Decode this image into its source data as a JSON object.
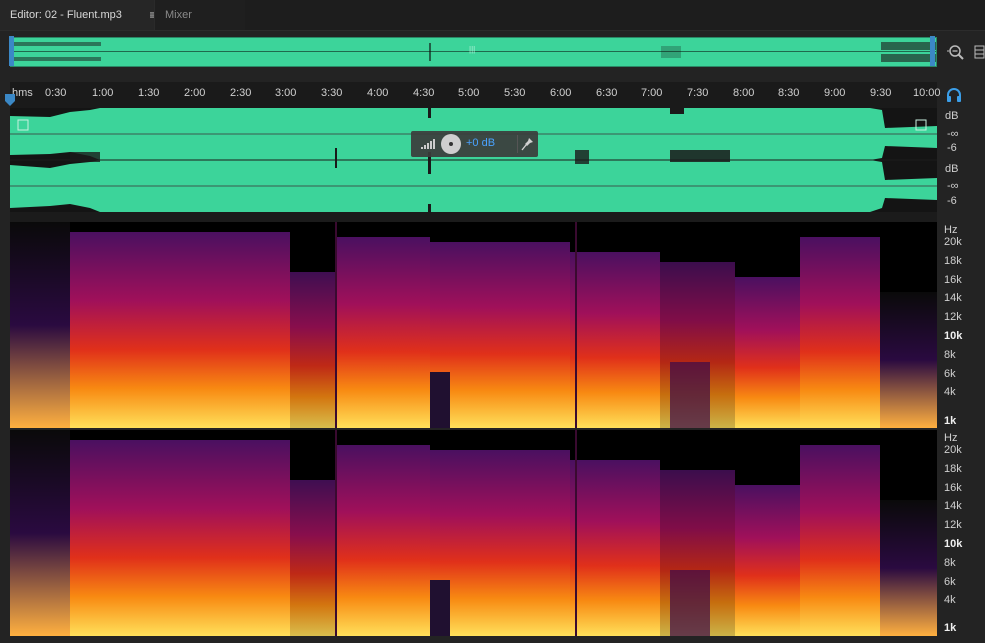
{
  "tabs": {
    "editor_label": "Editor: 02 - Fluent.mp3",
    "menu_glyph": "≡",
    "mixer_label": "Mixer"
  },
  "overview": {
    "selection_marker": "|||"
  },
  "ruler": {
    "unit": "hms",
    "ticks": [
      "0:30",
      "1:00",
      "1:30",
      "2:00",
      "2:30",
      "3:00",
      "3:30",
      "4:00",
      "4:30",
      "5:00",
      "5:30",
      "6:00",
      "6:30",
      "7:00",
      "7:30",
      "8:00",
      "8:30",
      "9:00",
      "9:30",
      "10:00"
    ]
  },
  "waveform": {
    "color": "#3cd49a",
    "top_channel_labels": [
      "dB",
      "-∞",
      "-6"
    ],
    "bottom_channel_labels": [
      "dB",
      "-∞",
      "-6"
    ]
  },
  "hud": {
    "value": "+0 dB"
  },
  "spectral": {
    "unit": "Hz",
    "labels": [
      "20k",
      "18k",
      "16k",
      "14k",
      "12k",
      "10k",
      "8k",
      "6k",
      "4k",
      "1k"
    ]
  },
  "icons": {
    "zoom": "zoom-magnifier-icon",
    "headphones": "headphones-icon",
    "pin": "pin-icon",
    "bars": "level-bars-icon",
    "side_menu": "panel-menu-icon"
  }
}
